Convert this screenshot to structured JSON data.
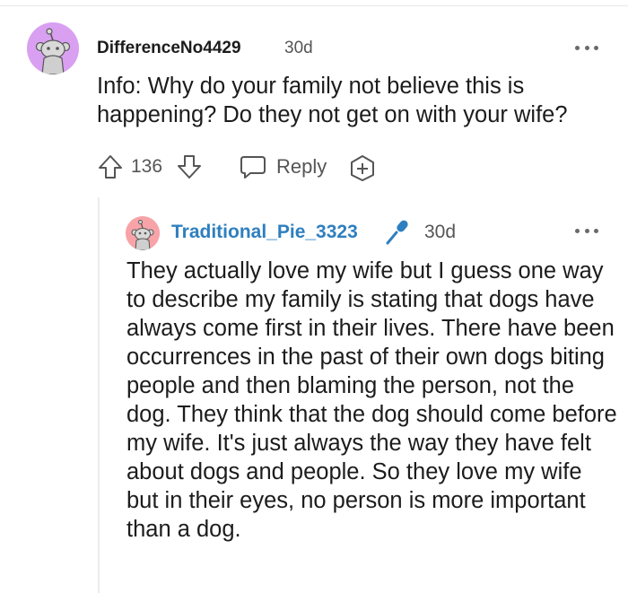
{
  "comment": {
    "username": "DifferenceNo4429",
    "age": "30d",
    "body": "Info: Why do your family not believe this is happening? Do they not get on with your wife?",
    "score": "136",
    "reply_label": "Reply",
    "avatar_color": "#d9a0f2"
  },
  "reply": {
    "username": "Traditional_Pie_3323",
    "age": "30d",
    "body": "They actually love my wife but I guess one way to describe my family is stating that dogs have always come first in their lives. There have been occurrences in the past of their own dogs biting people and then blaming the person, not the dog. They think that the dog should come before my wife. It's just always the way they have felt about dogs and people. So they love my wife but in their eyes, no person is more important than a dog.",
    "username_color": "#2e7fbf",
    "avatar_color": "#f7a3a8",
    "badge_icon": "microphone-icon"
  },
  "icons": {
    "upvote": "arrow-up-icon",
    "downvote": "arrow-down-icon",
    "reply": "speech-bubble-icon",
    "award": "award-plus-icon",
    "more": "more-dots-icon"
  }
}
